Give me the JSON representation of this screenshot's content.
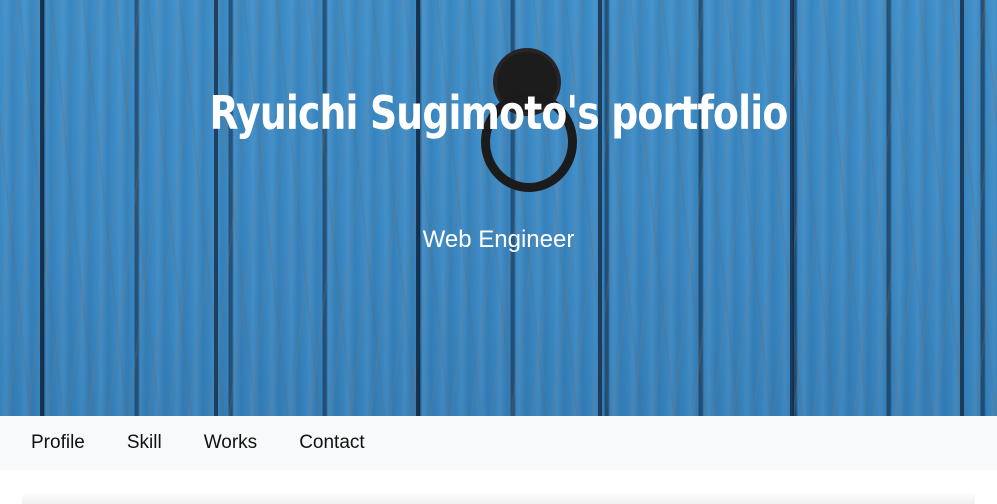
{
  "hero": {
    "title": "Ryuichi Sugimoto's portfolio",
    "subtitle": "Web Engineer",
    "background_color": "#3a88c4"
  },
  "nav": {
    "items": [
      {
        "label": "Profile"
      },
      {
        "label": "Skill"
      },
      {
        "label": "Works"
      },
      {
        "label": "Contact"
      }
    ],
    "background_color": "#f8f9fa"
  }
}
